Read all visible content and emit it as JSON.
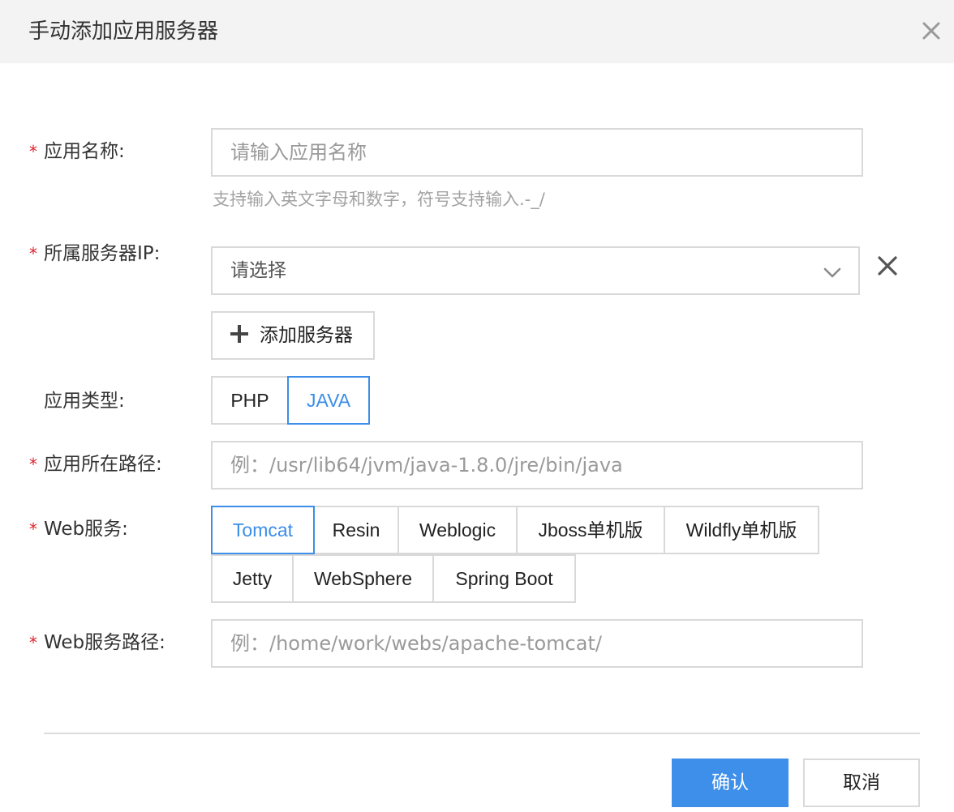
{
  "dialog": {
    "title": "手动添加应用服务器",
    "close_icon": "close-icon"
  },
  "form": {
    "app_name": {
      "required_mark": "*",
      "label": "应用名称:",
      "placeholder": "请输入应用名称",
      "hint": "支持输入英文字母和数字，符号支持输入.-_/"
    },
    "server_ip": {
      "required_mark": "*",
      "label": "所属服务器IP:",
      "selected": "请选择",
      "clear_icon": "close-icon",
      "dropdown_icon": "chevron-down-icon"
    },
    "add_server_button": {
      "icon": "plus-icon",
      "label": "添加服务器"
    },
    "app_type": {
      "label": "应用类型:",
      "options": [
        "PHP",
        "JAVA"
      ],
      "selected": "JAVA"
    },
    "app_path": {
      "required_mark": "*",
      "label": "应用所在路径:",
      "placeholder": "例：/usr/lib64/jvm/java-1.8.0/jre/bin/java"
    },
    "web_service": {
      "required_mark": "*",
      "label": "Web服务:",
      "options": [
        "Tomcat",
        "Resin",
        "Weblogic",
        "Jboss单机版",
        "Wildfly单机版",
        "Jetty",
        "WebSphere",
        "Spring Boot"
      ],
      "selected": "Tomcat"
    },
    "web_service_path": {
      "required_mark": "*",
      "label": "Web服务路径:",
      "placeholder": "例：/home/work/webs/apache-tomcat/"
    }
  },
  "footer": {
    "confirm_label": "确认",
    "cancel_label": "取消"
  },
  "colors": {
    "accent": "#3e8fe9",
    "required": "#e0222d",
    "border": "#d9d9d9",
    "header_bg": "#f3f3f3"
  }
}
